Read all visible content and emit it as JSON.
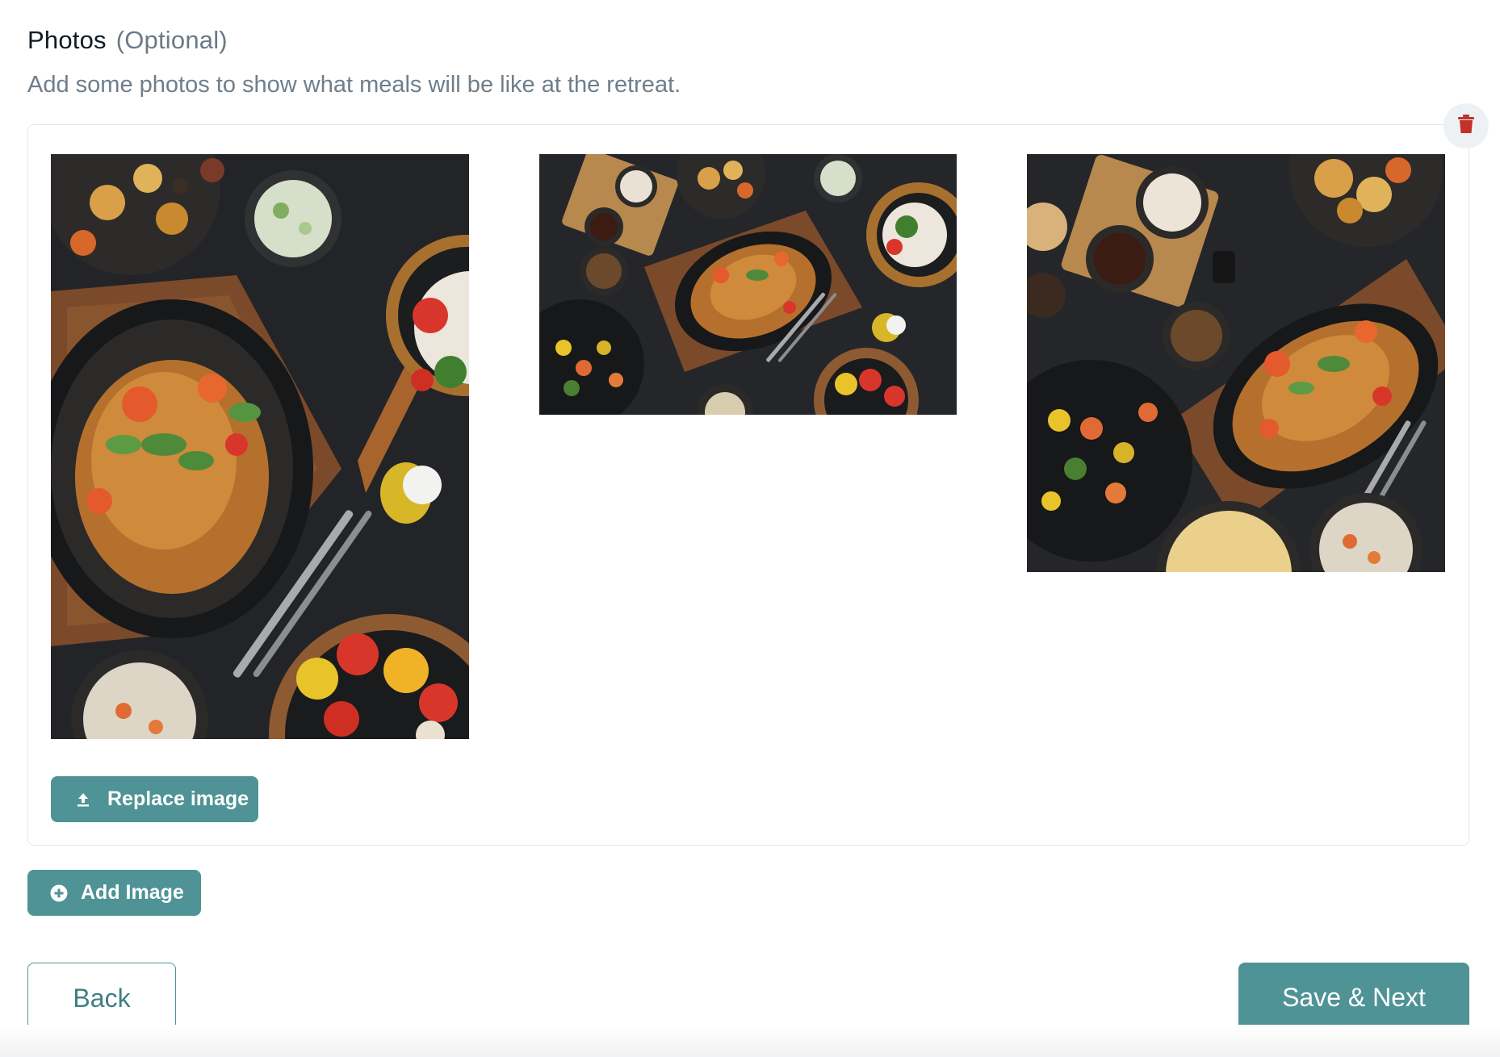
{
  "section": {
    "title": "Photos",
    "optional": "(Optional)",
    "subtitle": "Add some photos to show what meals will be like at the retreat."
  },
  "photos": [
    {
      "alt": "photo-portrait",
      "icon": "food-spread"
    },
    {
      "alt": "photo-landscape",
      "icon": "food-spread"
    },
    {
      "alt": "photo-square",
      "icon": "food-spread"
    }
  ],
  "actions": {
    "replace_label": "Replace image",
    "add_label": "Add Image",
    "back_label": "Back",
    "save_label": "Save & Next",
    "delete_icon": "trash-icon"
  },
  "colors": {
    "accent": "#4f9396",
    "delete": "#c0322b",
    "muted_text": "#6f7e8a"
  }
}
